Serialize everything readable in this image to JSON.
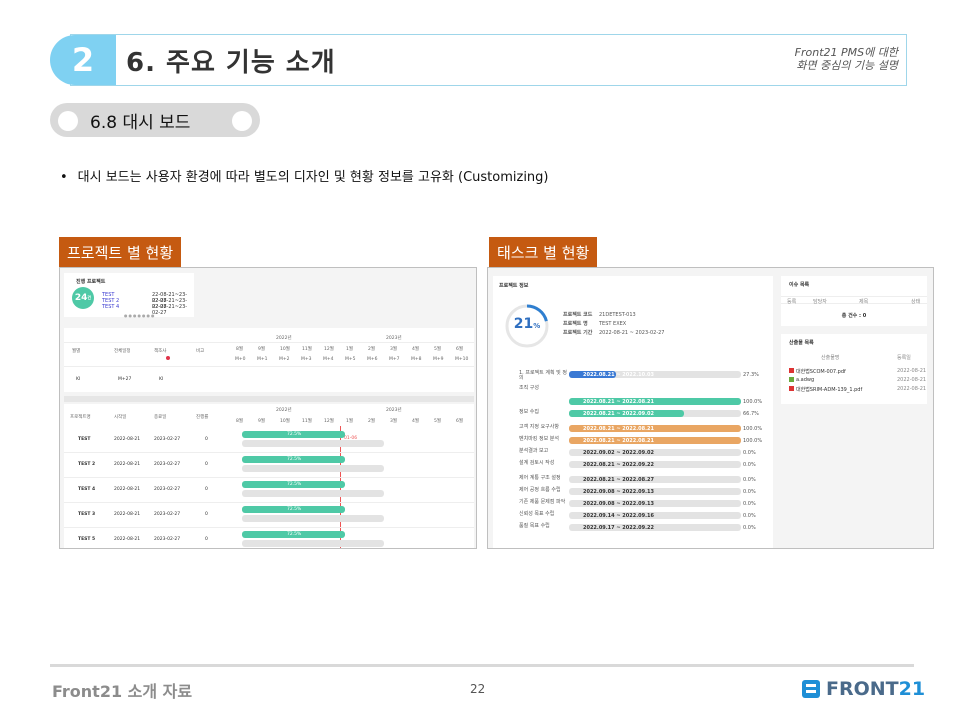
{
  "header": {
    "number": "2",
    "title": "6. 주요 기능 소개",
    "subtitle_line1": "Front21 PMS에 대한",
    "subtitle_line2": "화면 중심의 기능 설명"
  },
  "section": {
    "label": "6.8 대시 보드"
  },
  "bullet": {
    "text": "대시 보드는 사용자 환경에 따라 별도의 디자인 및 현황 정보를 고유화 (Customizing)"
  },
  "left_panel": {
    "label": "프로젝트 별 현황",
    "card": {
      "title": "진행 프로젝트",
      "count": "24",
      "count_unit": "건",
      "items": [
        {
          "name": "TEST",
          "period": "22-08-21~23-02-27"
        },
        {
          "name": "TEST 2",
          "period": "22-08-21~23-02-27"
        },
        {
          "name": "TEST 4",
          "period": "22-08-21~23-02-27"
        }
      ]
    },
    "grid1": {
      "cols": [
        "월별",
        "전체일정",
        "책조사",
        "비고"
      ],
      "years": [
        "2022년",
        "2023년"
      ],
      "months": [
        "8월",
        "9월",
        "10월",
        "11월",
        "12월",
        "1월",
        "2월",
        "3월",
        "4월",
        "5월",
        "6월"
      ],
      "mlabels": [
        "M+0",
        "M+1",
        "M+2",
        "M+3",
        "M+4",
        "M+5",
        "M+6",
        "M+7",
        "M+8",
        "M+9",
        "M+10"
      ],
      "row": [
        "KI",
        "M+27",
        "KI"
      ]
    },
    "grid2": {
      "cols": [
        "프로젝트명",
        "시작일",
        "종료일",
        "진행률"
      ],
      "years": [
        "2022년",
        "2023년"
      ],
      "months": [
        "8월",
        "9월",
        "10월",
        "11월",
        "12월",
        "1월",
        "2월",
        "3월",
        "4월",
        "5월",
        "6월"
      ],
      "rows": [
        {
          "name": "TEST",
          "start": "2022-08-21",
          "end": "2023-02-27",
          "rate": "0",
          "bar": "72.5%"
        },
        {
          "name": "TEST 2",
          "start": "2022-08-21",
          "end": "2023-02-27",
          "rate": "0",
          "bar": "72.5%"
        },
        {
          "name": "TEST 4",
          "start": "2022-08-21",
          "end": "2023-02-27",
          "rate": "0",
          "bar": "72.5%"
        },
        {
          "name": "TEST 3",
          "start": "2022-08-21",
          "end": "2023-02-27",
          "rate": "0",
          "bar": "72.5%"
        },
        {
          "name": "TEST 5",
          "start": "2022-08-21",
          "end": "2023-02-27",
          "rate": "0",
          "bar": "72.5%"
        }
      ],
      "today_marker": "01-06"
    }
  },
  "right_panel": {
    "label": "태스크 별 현황",
    "project_info": {
      "title": "프로젝트 정보",
      "percent": "21",
      "percent_unit": "%",
      "code_label": "프로젝트 코드",
      "code_value": "21DETEST-013",
      "name_label": "프로젝트 명",
      "name_value": "TEST EXEX",
      "period_label": "프로젝트 기간",
      "period_value": "2022-08-21 ~ 2023-02-27"
    },
    "tasks": [
      {
        "name": "1. 프로젝트 계획 및 정의",
        "range": "2022.08.21 ~ 2022.10.03",
        "pct": "27.3%",
        "color": "blue",
        "fill": 0.273
      },
      {
        "name": "조직 구성",
        "range": "",
        "pct": "",
        "color": "none",
        "fill": 0
      },
      {
        "name": "",
        "range": "2022.08.21 ~ 2022.08.21",
        "pct": "100.0%",
        "color": "teal",
        "fill": 1.0
      },
      {
        "name": "정보 수집",
        "range": "2022.08.21 ~ 2022.09.02",
        "pct": "66.7%",
        "color": "teal",
        "fill": 0.667
      },
      {
        "name": "고객 지정 요구사항",
        "range": "2022.08.21 ~ 2022.08.21",
        "pct": "100.0%",
        "color": "orange",
        "fill": 1.0
      },
      {
        "name": "벤치마킹 정보 분석",
        "range": "2022.08.21 ~ 2022.08.21",
        "pct": "100.0%",
        "color": "orange",
        "fill": 1.0
      },
      {
        "name": "분석결과 보고",
        "range": "2022.09.02 ~ 2022.09.02",
        "pct": "0.0%",
        "color": "gray",
        "fill": 0
      },
      {
        "name": "설계 검토시 작성",
        "range": "2022.08.21 ~ 2022.09.22",
        "pct": "0.0%",
        "color": "gray",
        "fill": 0
      },
      {
        "name": "제어 계통 구조 설정",
        "range": "2022.08.21 ~ 2022.08.27",
        "pct": "0.0%",
        "color": "gray",
        "fill": 0
      },
      {
        "name": "제어 공정 흐름 수립",
        "range": "2022.09.08 ~ 2022.09.13",
        "pct": "0.0%",
        "color": "gray",
        "fill": 0
      },
      {
        "name": "기존 제품 문제점 파악",
        "range": "2022.09.08 ~ 2022.09.13",
        "pct": "0.0%",
        "color": "gray",
        "fill": 0
      },
      {
        "name": "신뢰성 목표 수립",
        "range": "2022.09.14 ~ 2022.09.16",
        "pct": "0.0%",
        "color": "gray",
        "fill": 0
      },
      {
        "name": "품질 목표 수립",
        "range": "2022.09.17 ~ 2022.09.22",
        "pct": "0.0%",
        "color": "gray",
        "fill": 0
      }
    ],
    "issues": {
      "title": "이슈 목록",
      "cols": [
        "등록",
        "담당자",
        "제목",
        "상태"
      ],
      "total": "총 건수 : 0"
    },
    "outputs": {
      "title": "산출물 목록",
      "cols": [
        "산출물명",
        "등록일"
      ],
      "files": [
        {
          "name": "대한법SCOM-007.pdf",
          "date": "2022-08-21"
        },
        {
          "name": "a.adwg",
          "date": "2022-08-21"
        },
        {
          "name": "대한법SRIM-ADM-139_1.pdf",
          "date": "2022-08-21"
        }
      ]
    }
  },
  "footer": {
    "left": "Front21 소개 자료",
    "page": "22",
    "logo_a": "FRONT",
    "logo_b": "21"
  },
  "colors": {
    "accent_blue": "#7fd1f2",
    "label_orange": "#c55a11",
    "teal": "#4ec9a6",
    "bar_blue": "#3a79d4",
    "bar_orange": "#e9a663"
  }
}
